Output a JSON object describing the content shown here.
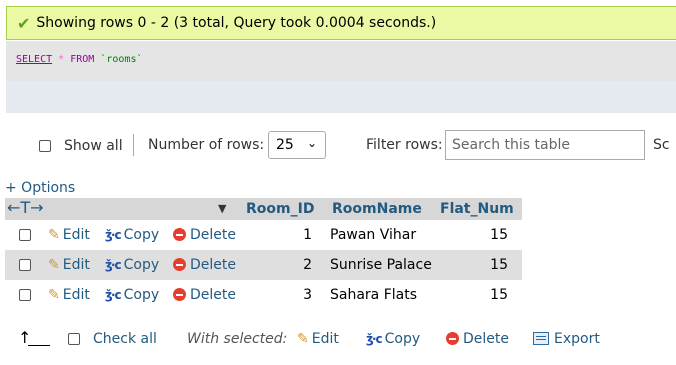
{
  "message": {
    "text": "Showing rows 0 - 2 (3 total, Query took 0.0004 seconds.)"
  },
  "sql": {
    "select": "SELECT",
    "star": "*",
    "from": "FROM",
    "table": "`rooms`"
  },
  "nav": {
    "show_all": "Show all",
    "number_of_rows_label": "Number of rows:",
    "rows_value": "25",
    "filter_label": "Filter rows:",
    "search_placeholder": "Search this table",
    "cut_text": "Sc"
  },
  "options_link": "+ Options",
  "columns": [
    "Room_ID",
    "RoomName",
    "Flat_Num"
  ],
  "actions": {
    "edit": "Edit",
    "copy": "Copy",
    "delete": "Delete"
  },
  "rows": [
    {
      "room_id": "1",
      "room_name": "Pawan Vihar",
      "flat_num": "15"
    },
    {
      "room_id": "2",
      "room_name": "Sunrise Palace",
      "flat_num": "15"
    },
    {
      "room_id": "3",
      "room_name": "Sahara Flats",
      "flat_num": "15"
    }
  ],
  "footer": {
    "check_all": "Check all",
    "with_selected": "With selected:",
    "edit": "Edit",
    "copy": "Copy",
    "delete": "Delete",
    "export": "Export"
  }
}
